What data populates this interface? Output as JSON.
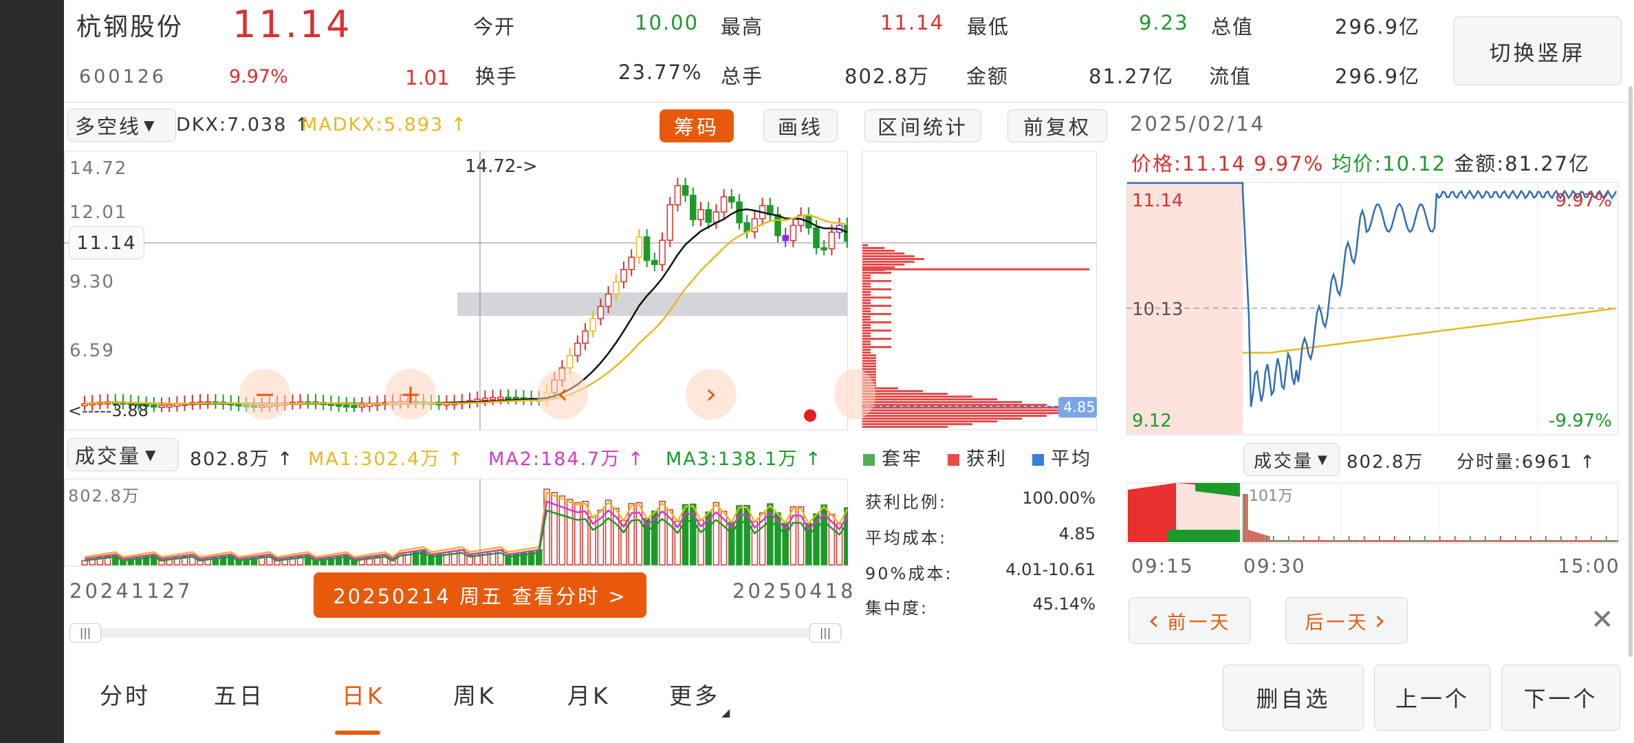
{
  "header": {
    "name": "杭钢股份",
    "price": "11.14",
    "code": "600126",
    "pct": "9.97%",
    "chg": "1.01",
    "stats": [
      {
        "label": "今开",
        "value": "10.00",
        "color": "green"
      },
      {
        "label": "最高",
        "value": "11.14",
        "color": "red"
      },
      {
        "label": "最低",
        "value": "9.23",
        "color": "green"
      },
      {
        "label": "总值",
        "value": "296.9亿",
        "color": "dark"
      },
      {
        "label": "换手",
        "value": "23.77%",
        "color": "dark"
      },
      {
        "label": "总手",
        "value": "802.8万",
        "color": "dark"
      },
      {
        "label": "金额",
        "value": "81.27亿",
        "color": "dark"
      },
      {
        "label": "流值",
        "value": "296.9亿",
        "color": "dark"
      }
    ],
    "switch_btn": "切换竖屏"
  },
  "kline": {
    "indicator_select": "多空线",
    "dkx": "DKX:7.038 ↑",
    "madkx": "MADKX:5.893 ↑",
    "btn_chips": "筹码",
    "btn_draw": "画线",
    "btn_range": "区间统计",
    "btn_adjust": "前复权",
    "y_labels": [
      "14.72",
      "12.01",
      "9.30",
      "6.59"
    ],
    "low_label": "3.88",
    "cur_price_label": "11.14",
    "high_annot": "14.72->",
    "low_annot": "<-----3.88",
    "vol_select": "成交量",
    "vol_value": "802.8万 ↑",
    "ma1": "MA1:302.4万 ↑",
    "ma2": "MA2:184.7万 ↑",
    "ma3": "MA3:138.1万 ↑",
    "vol_axis": "802.8万",
    "date_start": "20241127",
    "date_end": "20250418",
    "date_btn": "20250214 周五 查看分时 >"
  },
  "chips": {
    "avg_label": "4.85",
    "legend": [
      {
        "label": "套牢",
        "color": "#4caf50"
      },
      {
        "label": "获利",
        "color": "#e84a4a"
      },
      {
        "label": "平均",
        "color": "#3b7ddd"
      }
    ],
    "stats": [
      {
        "label": "获利比例:",
        "value": "100.00%"
      },
      {
        "label": "平均成本:",
        "value": "4.85"
      },
      {
        "label": "90%成本:",
        "value": "4.01-10.61"
      },
      {
        "label": "集中度:",
        "value": "45.14%"
      }
    ]
  },
  "intraday": {
    "date": "2025/02/14",
    "price": "价格:11.14",
    "pct": "9.97%",
    "avg": "均价:10.12",
    "amount": "金额:81.27亿",
    "top_left": "11.14",
    "top_right": "9.97%",
    "mid_left": "10.13",
    "bot_left": "9.12",
    "bot_right": "-9.97%",
    "vol_select": "成交量",
    "vol_value": "802.8万",
    "tick_vol": "分时量:6961 ↑",
    "vol_axis": "101万",
    "times": [
      "09:15",
      "09:30",
      "15:00"
    ],
    "prev_day": "前一天",
    "next_day": "后一天"
  },
  "tabs": [
    "分时",
    "五日",
    "日K",
    "周K",
    "月K",
    "更多"
  ],
  "bottom_buttons": [
    "删自选",
    "上一个",
    "下一个"
  ],
  "colors": {
    "up": "#d8302f",
    "down": "#1c9a2a",
    "accent": "#e8590c",
    "blue": "#2f6db5",
    "yellow": "#e8b820"
  }
}
